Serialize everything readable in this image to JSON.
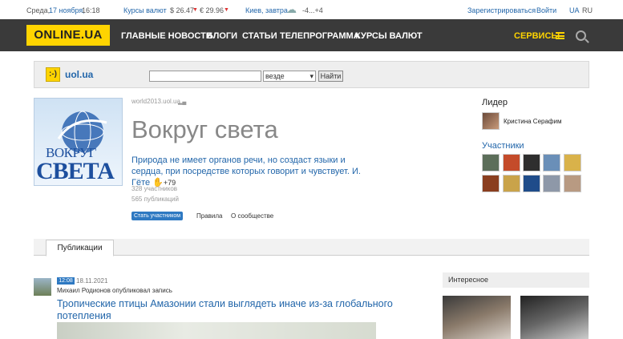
{
  "topbar": {
    "day": "Среда,",
    "date_link": "17 ноября,",
    "time": "16:18",
    "currency_label": "Курсы валют",
    "usd": "$ 26.47",
    "eur": "€ 29.96",
    "weather_link": "Киев, завтра",
    "temp": "-4...+4",
    "register": "Зарегистрироваться",
    "login": "Войти",
    "lang_ua": "UA",
    "lang_ru": "RU"
  },
  "nav": {
    "logo": "ONLINE.UA",
    "items": [
      "ГЛАВНЫЕ НОВОСТИ",
      "БЛОГИ",
      "СТАТЬИ",
      "ТЕЛЕПРОГРАММА",
      "КУРСЫ ВАЛЮТ"
    ],
    "services": "СЕРВИСЫ"
  },
  "uol": {
    "logo_glyph": ":-)",
    "name": "uol.ua",
    "select_value": "везде",
    "search_button": "Найти"
  },
  "community": {
    "cover_text_top": "ВОКРУГ",
    "cover_text_bottom": "СВЕТА",
    "domain": "world2013.uol.ua",
    "title": "Вокруг света",
    "description": "Природа не имеет органов речи, но создаст языки и сердца, при посредстве которых говорит и чувствует. И. Гёте",
    "likes": "+79",
    "members_count": "328 участников",
    "posts_count": "565 публикаций",
    "join_button": "Стать участником",
    "rules_link": "Правила",
    "about_link": "О сообществе"
  },
  "sidebar": {
    "leader_heading": "Лидер",
    "leader_name": "Кристина Серафим",
    "members_heading": "Участники"
  },
  "tabs": {
    "publications": "Публикации"
  },
  "post": {
    "time_badge": "12:08",
    "date": "18.11.2021",
    "author_line": "Михаил Родионов опубликовал запись",
    "title": "Тропические птицы Амазонии стали выглядеть иначе из-за глобального потепления"
  },
  "right": {
    "interesting_heading": "Интересное"
  }
}
